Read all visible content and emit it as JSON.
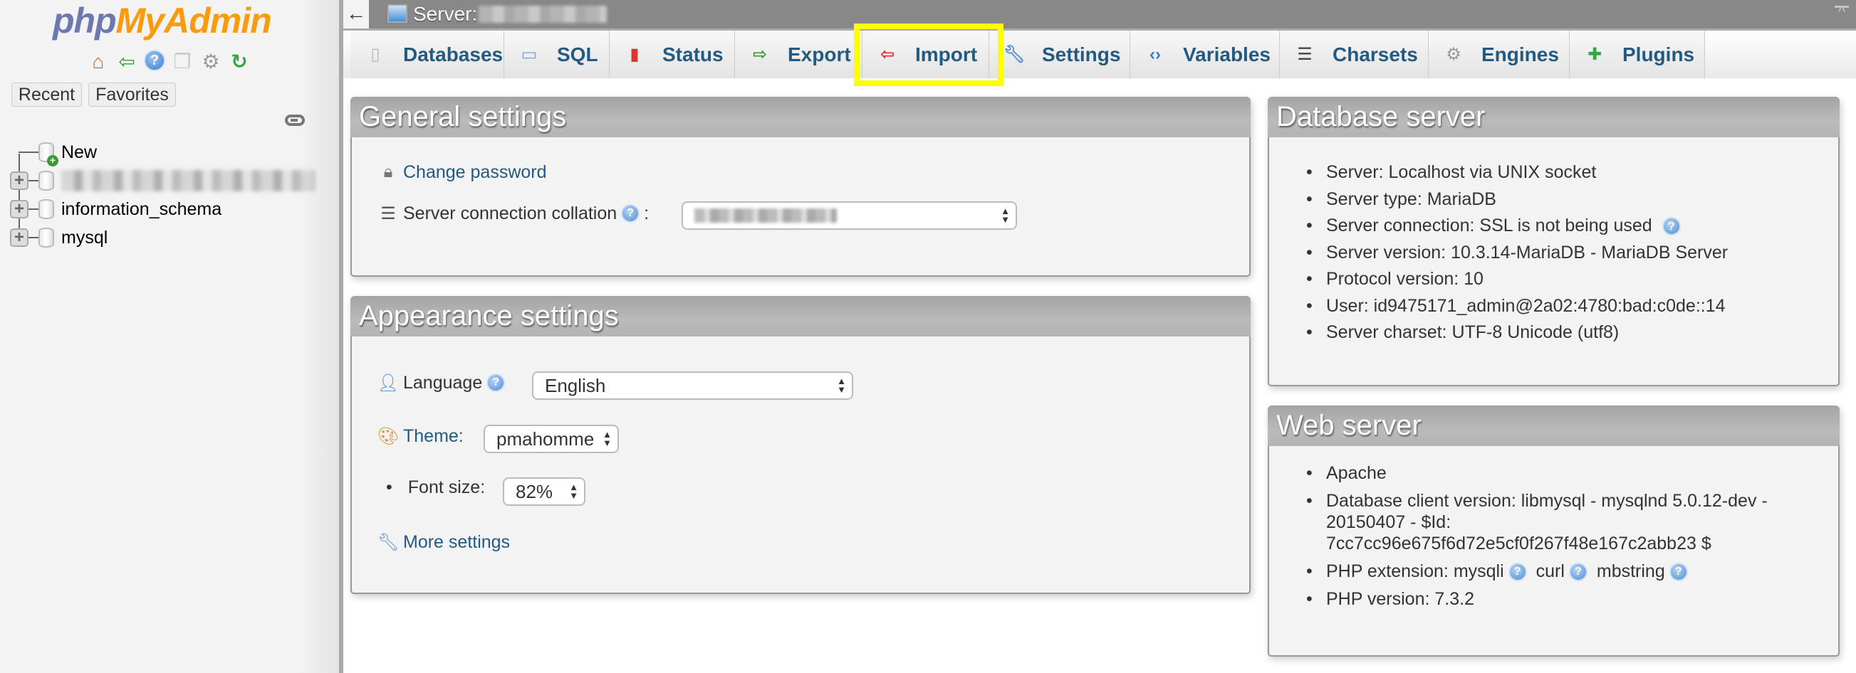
{
  "sidebar": {
    "logo": {
      "part1": "php",
      "part2": "MyAdmin"
    },
    "nav_icons": [
      "home-icon",
      "logout-icon",
      "help-icon",
      "documentation-icon",
      "settings-gear-icon",
      "reload-icon"
    ],
    "recent_label": "Recent",
    "favorites_label": "Favorites",
    "tree": [
      {
        "label": "New",
        "type": "new"
      },
      {
        "label": "[redacted database name]",
        "type": "database",
        "blurred": true
      },
      {
        "label": "information_schema",
        "type": "database"
      },
      {
        "label": "mysql",
        "type": "database"
      }
    ]
  },
  "topbar": {
    "back_glyph": "←",
    "server_label": "Server:",
    "server_name_blurred": true
  },
  "tabs": [
    {
      "label": "Databases",
      "icon": "database-icon"
    },
    {
      "label": "SQL",
      "icon": "sql-icon"
    },
    {
      "label": "Status",
      "icon": "status-icon"
    },
    {
      "label": "Export",
      "icon": "export-icon"
    },
    {
      "label": "Import",
      "icon": "import-icon",
      "highlighted": true
    },
    {
      "label": "Settings",
      "icon": "wrench-icon"
    },
    {
      "label": "Variables",
      "icon": "variables-icon"
    },
    {
      "label": "Charsets",
      "icon": "charsets-icon"
    },
    {
      "label": "Engines",
      "icon": "engines-icon"
    },
    {
      "label": "Plugins",
      "icon": "plugin-icon"
    }
  ],
  "general_settings": {
    "title": "General settings",
    "change_password": "Change password",
    "collation_label": "Server connection collation",
    "collation_colon": ":",
    "collation_value_blurred": true
  },
  "appearance_settings": {
    "title": "Appearance settings",
    "language_label": "Language",
    "language_value": "English",
    "theme_label": "Theme:",
    "theme_value": "pmahomme",
    "font_size_label": "Font size:",
    "font_size_value": "82%",
    "more_settings": "More settings"
  },
  "database_server": {
    "title": "Database server",
    "items": [
      "Server: Localhost via UNIX socket",
      "Server type: MariaDB",
      "Server connection: SSL is not being used",
      "Server version: 10.3.14-MariaDB - MariaDB Server",
      "Protocol version: 10",
      "User: id9475171_admin@2a02:4780:bad:c0de::14",
      "Server charset: UTF-8 Unicode (utf8)"
    ]
  },
  "web_server": {
    "title": "Web server",
    "items": [
      "Apache",
      "Database client version: libmysql - mysqlnd 5.0.12-dev - 20150407 - $Id: 7cc7cc96e675f6d72e5cf0f267f48e167c2abb23 $",
      "PHP extension:",
      "PHP version: 7.3.2"
    ],
    "php_extensions": [
      "mysqli",
      "curl",
      "mbstring"
    ]
  },
  "colors": {
    "link": "#235a81",
    "highlight": "#ffff00",
    "topbar": "#888888",
    "logo_php": "#6c78af",
    "logo_myadmin": "#f89c0e"
  }
}
